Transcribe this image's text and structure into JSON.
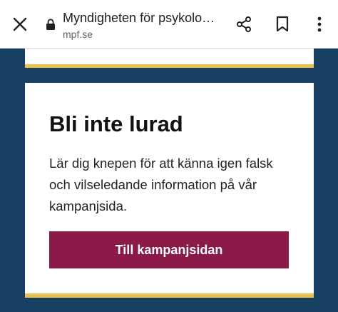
{
  "browser": {
    "page_title": "Myndigheten för psykolo…",
    "url": "mpf.se",
    "icons": {
      "close": "close-icon",
      "lock": "lock-icon",
      "share": "share-icon",
      "bookmark": "bookmark-icon",
      "more": "more-vert-icon"
    }
  },
  "card": {
    "heading": "Bli inte lurad",
    "body": "Lär dig knepen för att känna igen falsk och vilseledande information på vår kampanjsida.",
    "button_label": "Till kampanjsidan"
  },
  "colors": {
    "page_background": "#173f61",
    "accent_gold": "#e8c24a",
    "button": "#8b1a48"
  }
}
